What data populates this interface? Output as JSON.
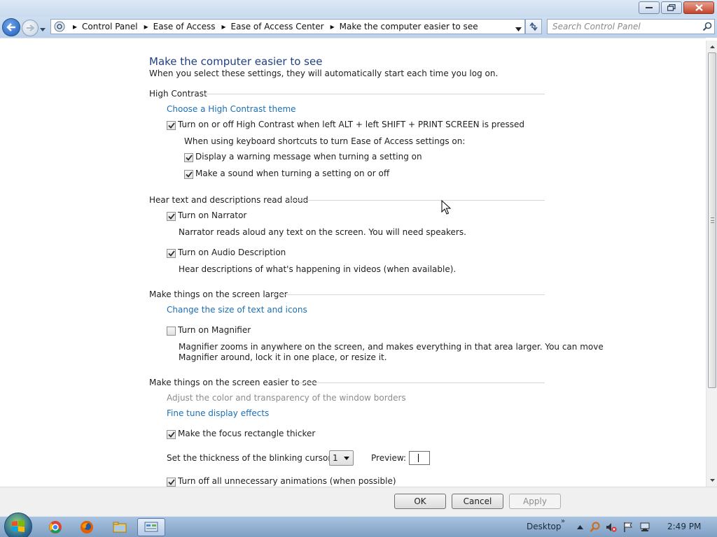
{
  "window": {
    "title": "Make the computer easier to see"
  },
  "address": {
    "breadcrumb": [
      "Control Panel",
      "Ease of Access",
      "Ease of Access Center",
      "Make the computer easier to see"
    ]
  },
  "search": {
    "placeholder": "Search Control Panel"
  },
  "page": {
    "title": "Make the computer easier to see",
    "subtitle": "When you select these settings, they will automatically start each time you log on.",
    "high_contrast": {
      "heading": "High Contrast",
      "theme_link": "Choose a High Contrast theme",
      "toggle_label": "Turn on or off High Contrast when left ALT + left SHIFT + PRINT SCREEN is pressed",
      "toggle_checked": true,
      "shortcut_intro": "When using keyboard shortcuts to turn Ease of Access settings on:",
      "warning_label": "Display a warning message when turning a setting on",
      "warning_checked": true,
      "sound_label": "Make a sound when turning a setting on or off",
      "sound_checked": true
    },
    "read_aloud": {
      "heading": "Hear text and descriptions read aloud",
      "narrator_label": "Turn on Narrator",
      "narrator_checked": true,
      "narrator_desc": "Narrator reads aloud any text on the screen. You will need speakers.",
      "audio_desc_label": "Turn on Audio Description",
      "audio_desc_checked": true,
      "audio_desc_desc": "Hear descriptions of what's happening in videos (when available)."
    },
    "larger": {
      "heading": "Make things on the screen larger",
      "size_link": "Change the size of text and icons",
      "magnifier_label": "Turn on Magnifier",
      "magnifier_checked": false,
      "magnifier_desc_1": "Magnifier zooms in anywhere on the screen, and makes everything in that area larger. You can move",
      "magnifier_desc_2": "Magnifier around, lock it in one place, or resize it."
    },
    "easier": {
      "heading": "Make things on the screen easier to see",
      "borders_link": "Adjust the color and transparency of the window borders",
      "display_effects_link": "Fine tune display effects",
      "focus_label": "Make the focus rectangle thicker",
      "focus_checked": true,
      "cursor_label": "Set the thickness of the blinking cursor:",
      "cursor_value": "1",
      "preview_label": "Preview:",
      "animations_label": "Turn off all unnecessary animations (when possible)",
      "animations_checked": true
    }
  },
  "buttons": {
    "ok": "OK",
    "cancel": "Cancel",
    "apply": "Apply"
  },
  "taskbar": {
    "desktop_label": "Desktop",
    "time": "2:49 PM",
    "pinned": [
      "chrome-icon",
      "firefox-icon",
      "file-explorer-icon",
      "control-panel-icon"
    ]
  },
  "colors": {
    "link": "#1b6fb5",
    "title": "#1e3f86",
    "disabled_text": "#8c8c8c"
  }
}
